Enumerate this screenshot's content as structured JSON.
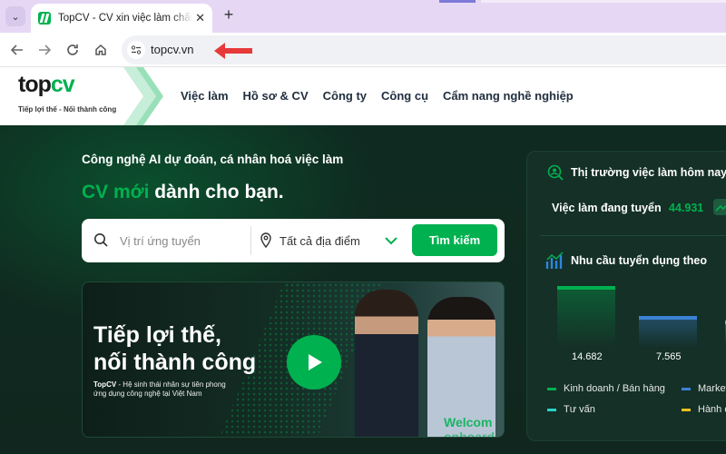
{
  "browser": {
    "tab_title": "TopCV - CV xin việc làm chất - T",
    "url": "topcv.vn"
  },
  "colors": {
    "brand": "#00b14f",
    "hero_bg": "#10291f",
    "arrow": "#e63a3a"
  },
  "header": {
    "logo_top": "top",
    "logo_cv": "cv",
    "tagline": "Tiếp lợi thế - Nối thành công",
    "nav": [
      "Việc làm",
      "Hồ sơ & CV",
      "Công ty",
      "Công cụ",
      "Cẩm nang nghề nghiệp"
    ]
  },
  "hero": {
    "subtitle": "Công nghệ AI dự đoán, cá nhân hoá việc làm",
    "headline_green": "CV mới",
    "headline_rest": " dành cho bạn.",
    "search_placeholder": "Vị trí ứng tuyển",
    "location": "Tất cả địa điểm",
    "search_button": "Tìm kiếm"
  },
  "banner": {
    "line1": "Tiếp lợi thế,",
    "line2": "nối thành công",
    "desc_brand": "TopCV",
    "desc": " - Hệ sinh thái nhân sự tiên phong ứng dụng công nghệ tại Việt Nam",
    "welcome": "Welcom",
    "onboard": "onboard"
  },
  "market": {
    "title": "Thị trường việc làm hôm nay:",
    "jobs_label": "Việc làm đang tuyển",
    "jobs_value": "44.931",
    "chart_title": "Nhu cầu tuyển dụng theo"
  },
  "chart_data": {
    "type": "bar",
    "values": [
      14682,
      7565
    ],
    "value_labels": [
      "14.682",
      "7.565"
    ],
    "legend": [
      {
        "label": "Kinh doanh / Bán hàng",
        "color": "#00b14f"
      },
      {
        "label": "Market",
        "color": "#3b82d6"
      },
      {
        "label": "Tư vấn",
        "color": "#2ad1c9"
      },
      {
        "label": "Hành c",
        "color": "#e8c21c"
      }
    ]
  }
}
